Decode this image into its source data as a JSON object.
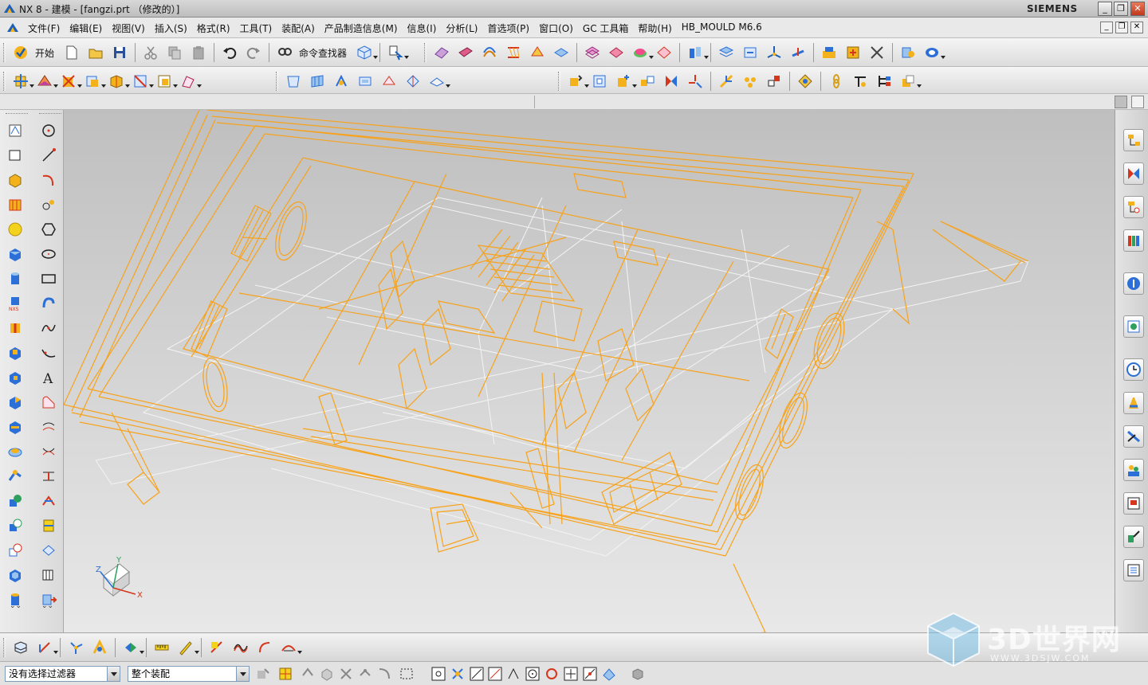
{
  "window": {
    "title": "NX 8 - 建模 - [fangzi.prt （修改的）]",
    "brand": "SIEMENS",
    "controls": [
      "_",
      "❐",
      "✕"
    ]
  },
  "menubar": {
    "items": [
      "文件(F)",
      "编辑(E)",
      "视图(V)",
      "插入(S)",
      "格式(R)",
      "工具(T)",
      "装配(A)",
      "产品制造信息(M)",
      "信息(I)",
      "分析(L)",
      "首选项(P)",
      "窗口(O)",
      "GC 工具箱",
      "帮助(H)",
      "HB_MOULD M6.6"
    ],
    "child_controls": [
      "_",
      "❐",
      "✕"
    ]
  },
  "toolbar": {
    "start_label": "开始",
    "command_finder_label": "命令查找器"
  },
  "status": {
    "selection_filter": "没有选择过滤器",
    "assembly_scope": "整个装配"
  },
  "triad": {
    "x": "X",
    "y": "Y",
    "z": "Z"
  },
  "watermark": {
    "text": "3D世界网",
    "url": "WWW.3DSJW.COM"
  },
  "colors": {
    "wire_orange": "#f7a21b",
    "wire_white": "#f4f4f4",
    "accent_blue": "#2c6fd6"
  }
}
